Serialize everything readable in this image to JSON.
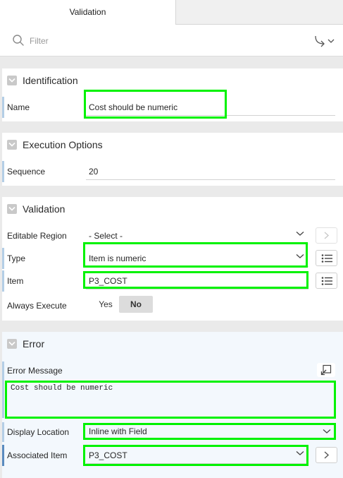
{
  "tabs": {
    "active": "Validation"
  },
  "filter": {
    "placeholder": "Filter"
  },
  "sections": {
    "identification": {
      "title": "Identification",
      "name_label": "Name",
      "name_value": "Cost should be numeric"
    },
    "execution": {
      "title": "Execution Options",
      "sequence_label": "Sequence",
      "sequence_value": "20"
    },
    "validation": {
      "title": "Validation",
      "editable_region_label": "Editable Region",
      "editable_region_value": "- Select -",
      "type_label": "Type",
      "type_value": "Item is numeric",
      "item_label": "Item",
      "item_value": "P3_COST",
      "always_execute_label": "Always Execute",
      "yes_label": "Yes",
      "no_label": "No",
      "always_execute_selected": "No"
    },
    "error": {
      "title": "Error",
      "message_label": "Error Message",
      "message_value": "Cost should be numeric",
      "display_location_label": "Display Location",
      "display_location_value": "Inline with Field",
      "associated_item_label": "Associated Item",
      "associated_item_value": "P3_COST"
    }
  },
  "colors": {
    "highlight": "#00f200",
    "row_marker": "#b4cee6",
    "row_marker_active": "#5a8bbf",
    "toggle": "#c9c9c9"
  },
  "icons": {
    "filter": "search-icon",
    "goto": "goto-arrow-icon",
    "section_toggle": "chevron-down-icon",
    "list": "list-icon",
    "next": "chevron-right-icon",
    "expand": "expand-icon"
  }
}
